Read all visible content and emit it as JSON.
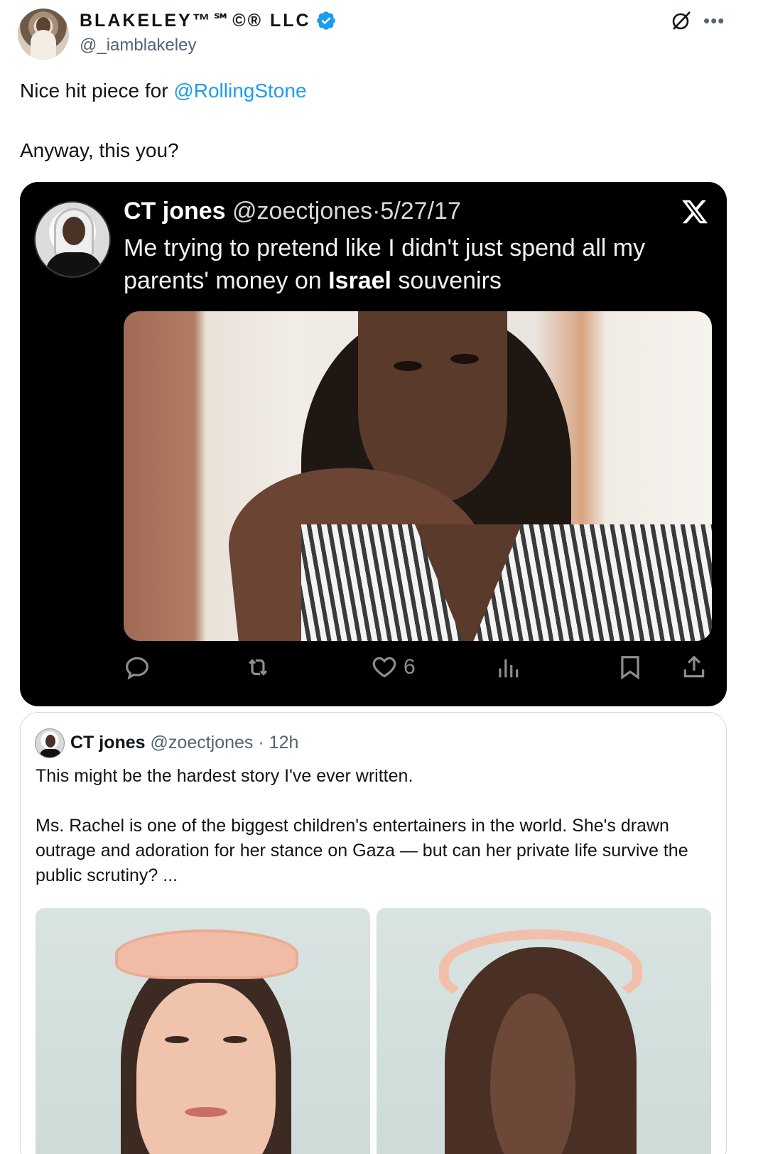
{
  "author": {
    "display_name": "BLAKELEY™℠©® LLC",
    "handle": "@_iamblakeley"
  },
  "tweet": {
    "line1_prefix": "Nice hit piece for ",
    "line1_mention": "@RollingStone",
    "line2": "Anyway, this you?"
  },
  "embedded": {
    "name": "CT jones",
    "handle": "@zoectjones",
    "separator": "·",
    "date": "5/27/17",
    "text_part1": "Me trying to pretend like I didn't just spend all my parents' money on ",
    "text_bold": "Israel",
    "text_part2": " souvenirs",
    "like_count": "6"
  },
  "quoted": {
    "name": "CT jones",
    "handle": "@zoectjones",
    "separator": "·",
    "time": "12h",
    "paragraph1": "This might be the hardest story I've ever written.",
    "paragraph2": "Ms. Rachel is one of the biggest children's entertainers in the world. She's drawn outrage and adoration for her stance on Gaza — but can her private life survive the public scrutiny? ..."
  },
  "icons": {
    "verified": "verified-badge-icon",
    "grok": "grok-icon",
    "more": "more-icon",
    "x_logo": "x-logo-icon",
    "reply": "reply-icon",
    "retweet": "retweet-icon",
    "like": "heart-icon",
    "views": "views-icon",
    "bookmark": "bookmark-icon",
    "share": "share-icon"
  },
  "colors": {
    "accent": "#1d9bf0",
    "text": "#0f1419",
    "muted": "#536471",
    "embed_bg": "#000000"
  }
}
